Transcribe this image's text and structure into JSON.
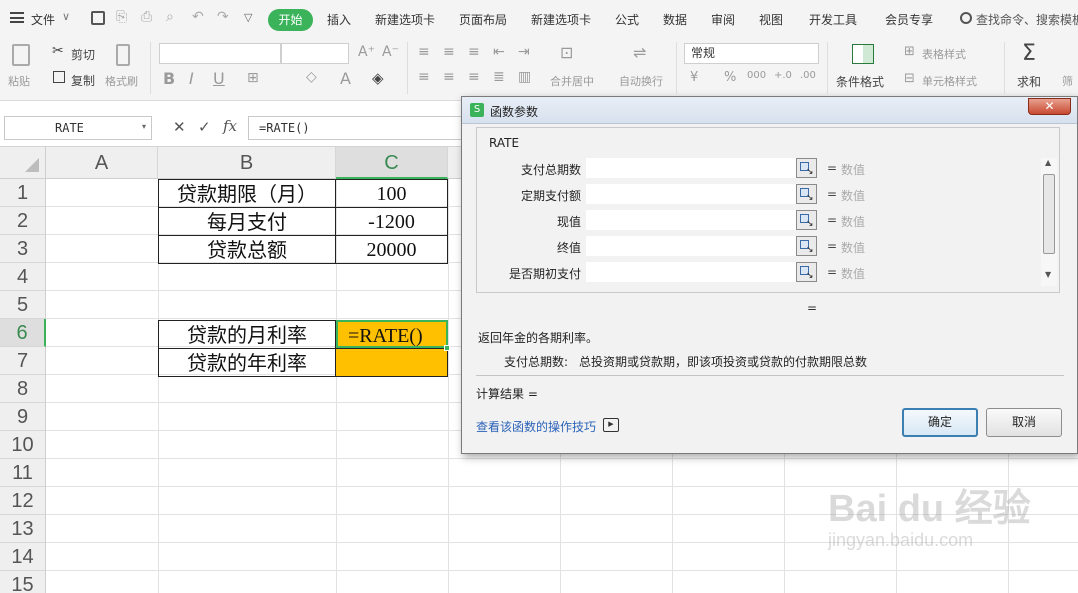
{
  "menubar": {
    "file_label": "文件",
    "tabs": [
      "开始",
      "插入",
      "新建选项卡",
      "页面布局",
      "新建选项卡",
      "公式",
      "数据",
      "审阅",
      "视图",
      "开发工具",
      "会员专享"
    ],
    "active_tab": "开始",
    "search_placeholder": "查找命令、搜索模板"
  },
  "toolbar": {
    "paste": "粘贴",
    "cut": "剪切",
    "copy": "复制",
    "format_painter": "格式刷",
    "merge_center": "合并居中",
    "auto_wrap": "自动换行",
    "number_format": "常规",
    "conditional_format": "条件格式",
    "table_style": "表格样式",
    "cell_style": "单元格样式",
    "sum": "求和",
    "filter": "筛"
  },
  "formula_bar": {
    "name_box": "RATE",
    "formula": "=RATE()"
  },
  "sheet": {
    "columns": [
      "A",
      "B",
      "C"
    ],
    "rows": [
      "1",
      "2",
      "3",
      "4",
      "5",
      "6",
      "7",
      "8",
      "9",
      "10",
      "11",
      "12",
      "13",
      "14",
      "15"
    ],
    "cells": {
      "B1": "贷款期限（月）",
      "C1": "100",
      "B2": "每月支付",
      "C2": "-1200",
      "B3": "贷款总额",
      "C3": "20000",
      "B6": "贷款的月利率",
      "C6": "=RATE()",
      "B7": "贷款的年利率",
      "C7": ""
    },
    "highlight_color": "#ffc000"
  },
  "dialog": {
    "title": "函数参数",
    "function_name": "RATE",
    "args": [
      {
        "label": "支付总期数",
        "hint": "数值"
      },
      {
        "label": "定期支付额",
        "hint": "数值"
      },
      {
        "label": "现值",
        "hint": "数值"
      },
      {
        "label": "终值",
        "hint": "数值"
      },
      {
        "label": "是否期初支付",
        "hint": "数值"
      }
    ],
    "eq_sign": "=",
    "description": "返回年金的各期利率。",
    "arg_help_label": "支付总期数:",
    "arg_help_text": "总投资期或贷款期，即该项投资或贷款的付款期限总数",
    "result_label": "计算结果 =",
    "tips_link": "查看该函数的操作技巧",
    "ok_label": "确定",
    "cancel_label": "取消"
  },
  "watermark": {
    "brand": "Bai du 经验",
    "url": "jingyan.baidu.com"
  }
}
